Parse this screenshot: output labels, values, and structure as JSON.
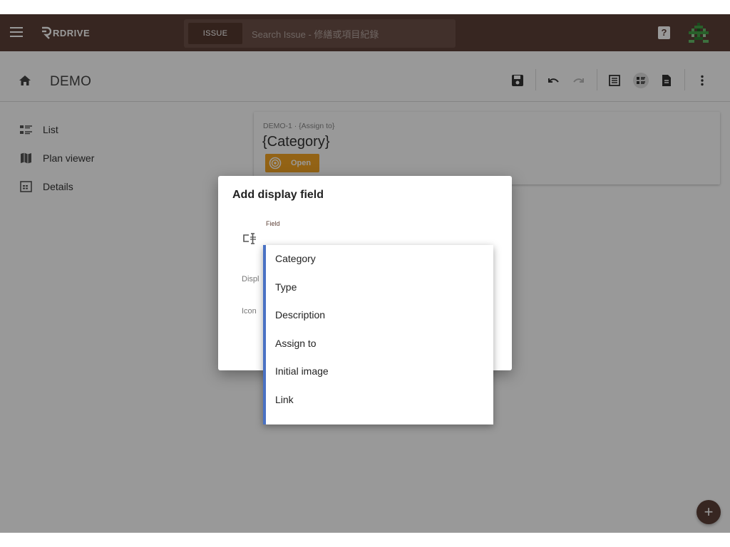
{
  "app": {
    "brand": "RDRIVE",
    "search": {
      "type_label": "ISSUE",
      "placeholder": "Search Issue - 修繕或項目紀錄"
    },
    "help_label": "?"
  },
  "header": {
    "title": "DEMO"
  },
  "sidebar": {
    "items": [
      {
        "label": "List",
        "icon": "list-icon"
      },
      {
        "label": "Plan viewer",
        "icon": "map-icon"
      },
      {
        "label": "Details",
        "icon": "details-icon"
      }
    ]
  },
  "card": {
    "meta": "DEMO-1 · {Assign to}",
    "title": "{Category}",
    "status": "Open",
    "status_color": "#f5a623"
  },
  "dialog": {
    "title": "Add display field",
    "field_label": "Field",
    "display_label": "Displ",
    "icon_label": "Icon"
  },
  "dropdown": {
    "options": [
      "Category",
      "Type",
      "Description",
      "Assign to",
      "Initial image",
      "Link"
    ]
  },
  "fab": {
    "label": "+"
  },
  "colors": {
    "brand": "#5d4037",
    "accent": "#4a72c4",
    "status_open": "#f5a623"
  }
}
